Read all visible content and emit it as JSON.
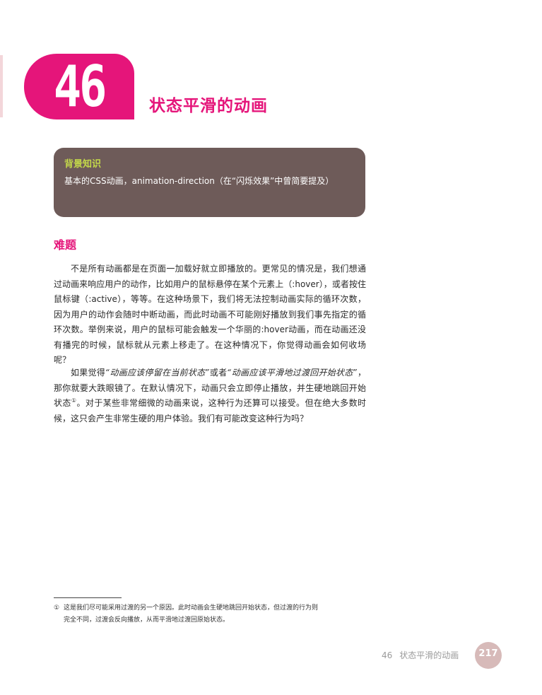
{
  "chapter": {
    "number": "46",
    "title": "状态平滑的动画"
  },
  "background_box": {
    "title": "背景知识",
    "text": "基本的CSS动画，animation-direction（在“闪烁效果”中曾简要提及）"
  },
  "section": {
    "heading": "难题"
  },
  "paragraphs": {
    "p1": "不是所有动画都是在页面一加载好就立即播放的。更常见的情况是，我们想通过动画来响应用户的动作，比如用户的鼠标悬停在某个元素上（:hover），或者按住鼠标键（:active），等等。在这种场景下，我们将无法控制动画实际的循环次数，因为用户的动作会随时中断动画，而此时动画不可能刚好播放到我们事先指定的循环次数。举例来说，用户的鼠标可能会触发一个华丽的:hover动画，而在动画还没有播完的时候，鼠标就从元素上移走了。在这种情况下，你觉得动画会如何收场呢？",
    "p2_pre": "如果觉得",
    "p2_quote1": "“动画应该停留在当前状态”",
    "p2_mid": "或者",
    "p2_quote2": "“动画应该平滑地过渡回开始状态”",
    "p2_post1": "，那你就要大跌眼镜了。在默认情况下，动画只会立即停止播放，并生硬地跳回开始状态",
    "p2_fnref": "①",
    "p2_post2": "。对于某些非常细微的动画来说，这种行为还算可以接受。但在绝大多数时候，这只会产生非常生硬的用户体验。我们有可能改变这种行为吗？"
  },
  "footnote": {
    "marker": "①",
    "line1": "这是我们尽可能采用过渡的另一个原因。此时动画会生硬地跳回开始状态，但过渡的行为则",
    "line2": "完全不同，过渡会反向播放，从而平滑地过渡回原始状态。"
  },
  "footer": {
    "chapter_number": "46",
    "chapter_title": "状态平滑的动画",
    "page_number": "217"
  },
  "colors": {
    "accent": "#e5157a",
    "box_bg": "#6e5b59",
    "box_title": "#c4d94a",
    "page_badge": "#d7bab9"
  }
}
